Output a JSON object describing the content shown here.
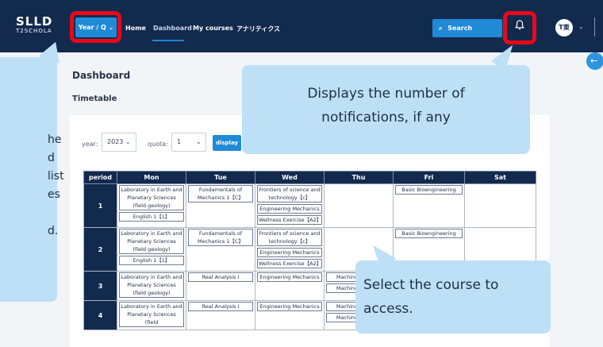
{
  "topbar": {
    "logo_mark": "ꓢꓡꓡꓓ",
    "logo_sub": "T2SCHOLA",
    "year_q_label": "Year / Q ⌄",
    "nav": [
      "Home",
      "Dashboard",
      "My courses",
      "アナリティクス"
    ],
    "search_label": "Search",
    "avatar_text": "T東",
    "colors": {
      "bar": "#132a4f",
      "accent": "#1f8ad6",
      "highlight": "#e8081a"
    }
  },
  "page": {
    "title": "Dashboard",
    "subtitle": "Timetable"
  },
  "filters": {
    "year_label": "year:",
    "year_value": "2023 ⌄",
    "quota_label": "quota:",
    "quota_value": "1",
    "display_label": "display"
  },
  "timetable": {
    "headers": [
      "period",
      "Mon",
      "Tue",
      "Wed",
      "Thu",
      "Fri",
      "Sat"
    ],
    "rows": [
      {
        "period": "1",
        "cells": [
          [
            "Laboratory in Earth and Planetary Sciences (field geology)",
            "English 1【1】"
          ],
          [
            "Fundamentals of Mechanics 1【C】"
          ],
          [
            "Frontiers of science and technology【c】",
            "Engineering Mechanics",
            "Wellness Exercise【A2】"
          ],
          [],
          [
            "Basic Bioengineering"
          ],
          []
        ]
      },
      {
        "period": "2",
        "cells": [
          [
            "Laboratory in Earth and Planetary Sciences (field geology)",
            "English 1【1】"
          ],
          [
            "Fundamentals of Mechanics 1【C】"
          ],
          [
            "Frontiers of science and technology【c】",
            "Engineering Mechanics",
            "Wellness Exercise【A2】"
          ],
          [],
          [
            "Basic Bioengineering"
          ],
          []
        ]
      },
      {
        "period": "3",
        "cells": [
          [
            "Laboratory in Earth and Planetary Sciences (field geology)"
          ],
          [
            "Real Analysis I"
          ],
          [
            "Engineering Mechanics"
          ],
          [
            "Machine Drawing",
            "Machine Drawing"
          ],
          [],
          []
        ]
      },
      {
        "period": "4",
        "cells": [
          [
            "Laboratory in Earth and Planetary Sciences (field"
          ],
          [
            "Real Analysis I"
          ],
          [
            "Engineering Mechanics"
          ],
          [
            "Machine Drawing",
            "Machine Drawing"
          ],
          [],
          []
        ]
      }
    ]
  },
  "callouts": {
    "notifications": "Displays the number of notifications, if any",
    "notifications_lines": [
      "Displays the number of",
      "notifications, if any"
    ],
    "select_course_lines": [
      "Select the course to",
      "access."
    ],
    "left_fragments": [
      "he",
      "d",
      "list",
      "es",
      "d."
    ]
  }
}
